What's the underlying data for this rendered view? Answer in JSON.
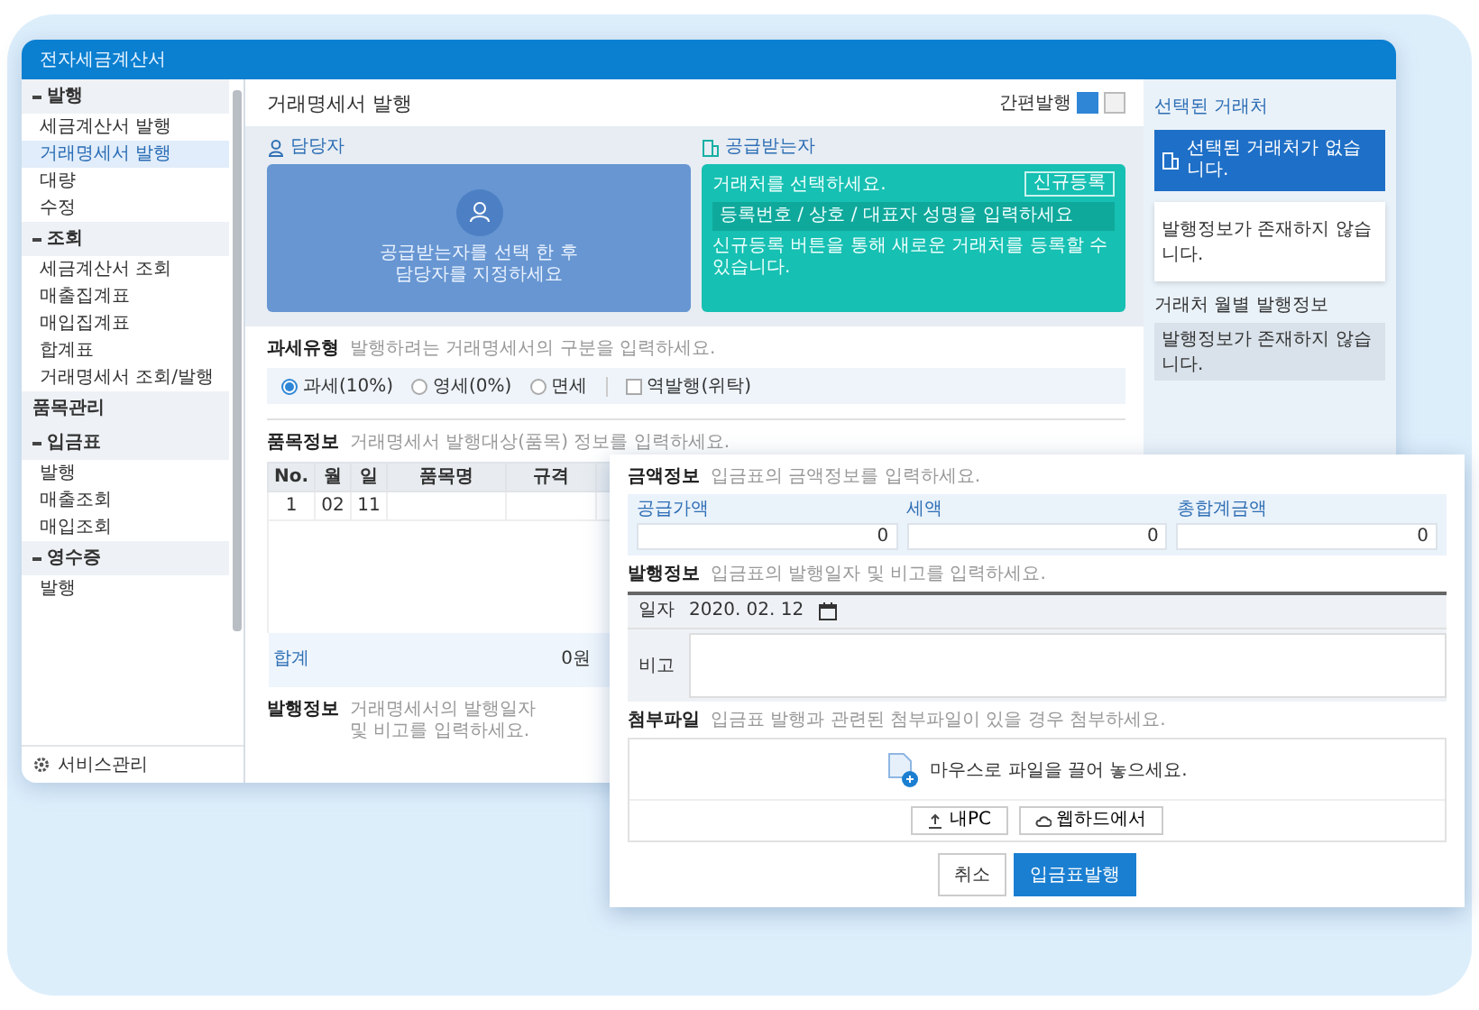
{
  "app_title": "전자세금계산서",
  "sidebar": {
    "groups": [
      {
        "label": "발행",
        "kind": "group",
        "expanded": true,
        "items": [
          {
            "label": "세금계산서 발행",
            "selected": false
          },
          {
            "label": "거래명세서 발행",
            "selected": true
          },
          {
            "label": "대량",
            "selected": false
          },
          {
            "label": "수정",
            "selected": false
          }
        ]
      },
      {
        "label": "조회",
        "kind": "group",
        "expanded": true,
        "items": [
          {
            "label": "세금계산서 조회",
            "selected": false
          },
          {
            "label": "매출집계표",
            "selected": false
          },
          {
            "label": "매입집계표",
            "selected": false
          },
          {
            "label": "합계표",
            "selected": false
          },
          {
            "label": "거래명세서 조회/발행",
            "selected": false
          }
        ]
      },
      {
        "label": "품목관리",
        "kind": "link"
      },
      {
        "label": "입금표",
        "kind": "group",
        "expanded": true,
        "items": [
          {
            "label": "발행",
            "selected": false
          },
          {
            "label": "매출조회",
            "selected": false
          },
          {
            "label": "매입조회",
            "selected": false
          }
        ]
      },
      {
        "label": "영수증",
        "kind": "group",
        "expanded": true,
        "items": [
          {
            "label": "발행",
            "selected": false
          }
        ]
      }
    ],
    "footer": "서비스관리"
  },
  "page_title": "거래명세서 발행",
  "view_toggle": {
    "label": "간편발행",
    "options": [
      {
        "selected": true
      },
      {
        "selected": false
      }
    ]
  },
  "manager": {
    "title": "담당자",
    "lines": [
      "공급받는자를 선택 한 후",
      "담당자를 지정하세요"
    ]
  },
  "buyer": {
    "title": "공급받는자",
    "prompt": "거래처를 선택하세요.",
    "button": "신규등록",
    "placeholder": "등록번호 / 상호 / 대표자 성명을 입력하세요",
    "note": "신규등록 버튼을 통해 새로운 거래처를 등록할 수 있습니다."
  },
  "tax_type": {
    "title": "과세유형",
    "hint": "발행하려는 거래명세서의 구분을 입력하세요.",
    "options": [
      {
        "label": "과세(10%)",
        "selected": true
      },
      {
        "label": "영세(0%)",
        "selected": false
      },
      {
        "label": "면세",
        "selected": false
      }
    ],
    "reverse": {
      "label": "역발행(위탁)",
      "checked": false
    }
  },
  "items": {
    "title": "품목정보",
    "hint": "거래명세서 발행대상(품목) 정보를 입력하세요.",
    "columns": [
      "No.",
      "월",
      "일",
      "품목명",
      "규격"
    ],
    "rows": [
      {
        "cells": [
          "1",
          "02",
          "11"
        ]
      }
    ],
    "total_label": "합계",
    "total_value": "0원"
  },
  "issue_info": {
    "title": "발행정보",
    "hint": "거래명세서의 발행일자 및 비고를 입력하세요."
  },
  "side_panel": {
    "title": "선택된 거래처",
    "banner": "선택된 거래처가 없습니다.",
    "card": "발행정보가 존재하지 않습니다.",
    "monthly_title": "거래처 월별 발행정보",
    "monthly_empty": "발행정보가 존재하지 않습니다."
  },
  "dialog": {
    "amount": {
      "title": "금액정보",
      "hint": "입금표의 금액정보를 입력하세요.",
      "fields": [
        {
          "label": "공급가액",
          "value": "0"
        },
        {
          "label": "세액",
          "value": "0"
        },
        {
          "label": "총합계금액",
          "value": "0"
        }
      ]
    },
    "issue": {
      "title": "발행정보",
      "hint": "입금표의 발행일자 및 비고를 입력하세요.",
      "date_label": "일자",
      "date": "2020. 02. 12",
      "memo_label": "비고"
    },
    "attachment": {
      "title": "첨부파일",
      "hint": "입금표 발행과 관련된 첨부파일이 있을 경우 첨부하세요.",
      "drop_text": "마우스로 파일을 끌어 놓으세요.",
      "buttons": [
        {
          "label": "내PC",
          "kind": "upload"
        },
        {
          "label": "웹하드에서",
          "kind": "cloud"
        }
      ]
    },
    "buttons": [
      {
        "label": "취소",
        "kind": "secondary"
      },
      {
        "label": "입금표발행",
        "kind": "primary"
      }
    ]
  }
}
